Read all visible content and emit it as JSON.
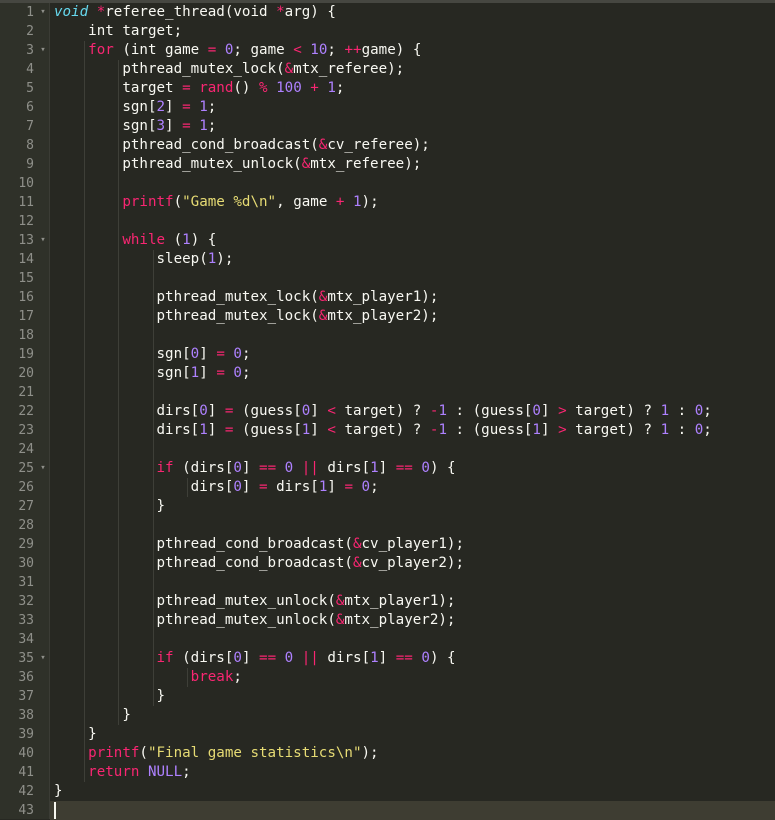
{
  "editor": {
    "theme_colors": {
      "background": "#272822",
      "gutter": "#2f3129",
      "keyword": "#f92672",
      "number": "#ae81ff",
      "string": "#e6db74",
      "text": "#f8f8f2"
    },
    "fold_icon": "fold-arrow-icon",
    "current_line": 43,
    "lines": [
      {
        "n": "1",
        "fold": true,
        "tokens": [
          [
            "t",
            "void"
          ],
          [
            "p",
            " "
          ],
          [
            "o",
            "*"
          ],
          [
            "p",
            "referee_thread(void "
          ],
          [
            "o",
            "*"
          ],
          [
            "p",
            "arg) {"
          ]
        ]
      },
      {
        "n": "2",
        "tokens": [
          [
            "p",
            "    int target;"
          ]
        ]
      },
      {
        "n": "3",
        "fold": true,
        "tokens": [
          [
            "p",
            "    "
          ],
          [
            "k",
            "for"
          ],
          [
            "p",
            " (int game "
          ],
          [
            "o",
            "="
          ],
          [
            "p",
            " "
          ],
          [
            "n",
            "0"
          ],
          [
            "p",
            "; game "
          ],
          [
            "o",
            "<"
          ],
          [
            "p",
            " "
          ],
          [
            "n",
            "10"
          ],
          [
            "p",
            "; "
          ],
          [
            "o",
            "++"
          ],
          [
            "p",
            "game) {"
          ]
        ]
      },
      {
        "n": "4",
        "tokens": [
          [
            "p",
            "        pthread_mutex_lock("
          ],
          [
            "o",
            "&"
          ],
          [
            "p",
            "mtx_referee);"
          ]
        ]
      },
      {
        "n": "5",
        "tokens": [
          [
            "p",
            "        target "
          ],
          [
            "o",
            "="
          ],
          [
            "p",
            " "
          ],
          [
            "k",
            "rand"
          ],
          [
            "p",
            "() "
          ],
          [
            "o",
            "%"
          ],
          [
            "p",
            " "
          ],
          [
            "n",
            "100"
          ],
          [
            "p",
            " "
          ],
          [
            "o",
            "+"
          ],
          [
            "p",
            " "
          ],
          [
            "n",
            "1"
          ],
          [
            "p",
            ";"
          ]
        ]
      },
      {
        "n": "6",
        "tokens": [
          [
            "p",
            "        sgn["
          ],
          [
            "n",
            "2"
          ],
          [
            "p",
            "] "
          ],
          [
            "o",
            "="
          ],
          [
            "p",
            " "
          ],
          [
            "n",
            "1"
          ],
          [
            "p",
            ";"
          ]
        ]
      },
      {
        "n": "7",
        "tokens": [
          [
            "p",
            "        sgn["
          ],
          [
            "n",
            "3"
          ],
          [
            "p",
            "] "
          ],
          [
            "o",
            "="
          ],
          [
            "p",
            " "
          ],
          [
            "n",
            "1"
          ],
          [
            "p",
            ";"
          ]
        ]
      },
      {
        "n": "8",
        "tokens": [
          [
            "p",
            "        pthread_cond_broadcast("
          ],
          [
            "o",
            "&"
          ],
          [
            "p",
            "cv_referee);"
          ]
        ]
      },
      {
        "n": "9",
        "tokens": [
          [
            "p",
            "        pthread_mutex_unlock("
          ],
          [
            "o",
            "&"
          ],
          [
            "p",
            "mtx_referee);"
          ]
        ]
      },
      {
        "n": "10",
        "tokens": []
      },
      {
        "n": "11",
        "tokens": [
          [
            "p",
            "        "
          ],
          [
            "k",
            "printf"
          ],
          [
            "p",
            "("
          ],
          [
            "s",
            "\"Game %d\\n\""
          ],
          [
            "p",
            ", game "
          ],
          [
            "o",
            "+"
          ],
          [
            "p",
            " "
          ],
          [
            "n",
            "1"
          ],
          [
            "p",
            ");"
          ]
        ]
      },
      {
        "n": "12",
        "tokens": []
      },
      {
        "n": "13",
        "fold": true,
        "tokens": [
          [
            "p",
            "        "
          ],
          [
            "k",
            "while"
          ],
          [
            "p",
            " ("
          ],
          [
            "n",
            "1"
          ],
          [
            "p",
            ") {"
          ]
        ]
      },
      {
        "n": "14",
        "tokens": [
          [
            "p",
            "            sleep("
          ],
          [
            "n",
            "1"
          ],
          [
            "p",
            ");"
          ]
        ]
      },
      {
        "n": "15",
        "tokens": []
      },
      {
        "n": "16",
        "tokens": [
          [
            "p",
            "            pthread_mutex_lock("
          ],
          [
            "o",
            "&"
          ],
          [
            "p",
            "mtx_player1);"
          ]
        ]
      },
      {
        "n": "17",
        "tokens": [
          [
            "p",
            "            pthread_mutex_lock("
          ],
          [
            "o",
            "&"
          ],
          [
            "p",
            "mtx_player2);"
          ]
        ]
      },
      {
        "n": "18",
        "tokens": []
      },
      {
        "n": "19",
        "tokens": [
          [
            "p",
            "            sgn["
          ],
          [
            "n",
            "0"
          ],
          [
            "p",
            "] "
          ],
          [
            "o",
            "="
          ],
          [
            "p",
            " "
          ],
          [
            "n",
            "0"
          ],
          [
            "p",
            ";"
          ]
        ]
      },
      {
        "n": "20",
        "tokens": [
          [
            "p",
            "            sgn["
          ],
          [
            "n",
            "1"
          ],
          [
            "p",
            "] "
          ],
          [
            "o",
            "="
          ],
          [
            "p",
            " "
          ],
          [
            "n",
            "0"
          ],
          [
            "p",
            ";"
          ]
        ]
      },
      {
        "n": "21",
        "tokens": []
      },
      {
        "n": "22",
        "tokens": [
          [
            "p",
            "            dirs["
          ],
          [
            "n",
            "0"
          ],
          [
            "p",
            "] "
          ],
          [
            "o",
            "="
          ],
          [
            "p",
            " (guess["
          ],
          [
            "n",
            "0"
          ],
          [
            "p",
            "] "
          ],
          [
            "o",
            "<"
          ],
          [
            "p",
            " target) ? "
          ],
          [
            "o",
            "-"
          ],
          [
            "n",
            "1"
          ],
          [
            "p",
            " : (guess["
          ],
          [
            "n",
            "0"
          ],
          [
            "p",
            "] "
          ],
          [
            "o",
            ">"
          ],
          [
            "p",
            " target) ? "
          ],
          [
            "n",
            "1"
          ],
          [
            "p",
            " : "
          ],
          [
            "n",
            "0"
          ],
          [
            "p",
            ";"
          ]
        ]
      },
      {
        "n": "23",
        "tokens": [
          [
            "p",
            "            dirs["
          ],
          [
            "n",
            "1"
          ],
          [
            "p",
            "] "
          ],
          [
            "o",
            "="
          ],
          [
            "p",
            " (guess["
          ],
          [
            "n",
            "1"
          ],
          [
            "p",
            "] "
          ],
          [
            "o",
            "<"
          ],
          [
            "p",
            " target) ? "
          ],
          [
            "o",
            "-"
          ],
          [
            "n",
            "1"
          ],
          [
            "p",
            " : (guess["
          ],
          [
            "n",
            "1"
          ],
          [
            "p",
            "] "
          ],
          [
            "o",
            ">"
          ],
          [
            "p",
            " target) ? "
          ],
          [
            "n",
            "1"
          ],
          [
            "p",
            " : "
          ],
          [
            "n",
            "0"
          ],
          [
            "p",
            ";"
          ]
        ]
      },
      {
        "n": "24",
        "tokens": []
      },
      {
        "n": "25",
        "fold": true,
        "tokens": [
          [
            "p",
            "            "
          ],
          [
            "k",
            "if"
          ],
          [
            "p",
            " (dirs["
          ],
          [
            "n",
            "0"
          ],
          [
            "p",
            "] "
          ],
          [
            "o",
            "=="
          ],
          [
            "p",
            " "
          ],
          [
            "n",
            "0"
          ],
          [
            "p",
            " "
          ],
          [
            "o",
            "||"
          ],
          [
            "p",
            " dirs["
          ],
          [
            "n",
            "1"
          ],
          [
            "p",
            "] "
          ],
          [
            "o",
            "=="
          ],
          [
            "p",
            " "
          ],
          [
            "n",
            "0"
          ],
          [
            "p",
            ") {"
          ]
        ]
      },
      {
        "n": "26",
        "tokens": [
          [
            "p",
            "                dirs["
          ],
          [
            "n",
            "0"
          ],
          [
            "p",
            "] "
          ],
          [
            "o",
            "="
          ],
          [
            "p",
            " dirs["
          ],
          [
            "n",
            "1"
          ],
          [
            "p",
            "] "
          ],
          [
            "o",
            "="
          ],
          [
            "p",
            " "
          ],
          [
            "n",
            "0"
          ],
          [
            "p",
            ";"
          ]
        ]
      },
      {
        "n": "27",
        "tokens": [
          [
            "p",
            "            }"
          ]
        ]
      },
      {
        "n": "28",
        "tokens": []
      },
      {
        "n": "29",
        "tokens": [
          [
            "p",
            "            pthread_cond_broadcast("
          ],
          [
            "o",
            "&"
          ],
          [
            "p",
            "cv_player1);"
          ]
        ]
      },
      {
        "n": "30",
        "tokens": [
          [
            "p",
            "            pthread_cond_broadcast("
          ],
          [
            "o",
            "&"
          ],
          [
            "p",
            "cv_player2);"
          ]
        ]
      },
      {
        "n": "31",
        "tokens": []
      },
      {
        "n": "32",
        "tokens": [
          [
            "p",
            "            pthread_mutex_unlock("
          ],
          [
            "o",
            "&"
          ],
          [
            "p",
            "mtx_player1);"
          ]
        ]
      },
      {
        "n": "33",
        "tokens": [
          [
            "p",
            "            pthread_mutex_unlock("
          ],
          [
            "o",
            "&"
          ],
          [
            "p",
            "mtx_player2);"
          ]
        ]
      },
      {
        "n": "34",
        "tokens": []
      },
      {
        "n": "35",
        "fold": true,
        "tokens": [
          [
            "p",
            "            "
          ],
          [
            "k",
            "if"
          ],
          [
            "p",
            " (dirs["
          ],
          [
            "n",
            "0"
          ],
          [
            "p",
            "] "
          ],
          [
            "o",
            "=="
          ],
          [
            "p",
            " "
          ],
          [
            "n",
            "0"
          ],
          [
            "p",
            " "
          ],
          [
            "o",
            "||"
          ],
          [
            "p",
            " dirs["
          ],
          [
            "n",
            "1"
          ],
          [
            "p",
            "] "
          ],
          [
            "o",
            "=="
          ],
          [
            "p",
            " "
          ],
          [
            "n",
            "0"
          ],
          [
            "p",
            ") {"
          ]
        ]
      },
      {
        "n": "36",
        "tokens": [
          [
            "p",
            "                "
          ],
          [
            "k",
            "break"
          ],
          [
            "p",
            ";"
          ]
        ]
      },
      {
        "n": "37",
        "tokens": [
          [
            "p",
            "            }"
          ]
        ]
      },
      {
        "n": "38",
        "tokens": [
          [
            "p",
            "        }"
          ]
        ]
      },
      {
        "n": "39",
        "tokens": [
          [
            "p",
            "    }"
          ]
        ]
      },
      {
        "n": "40",
        "tokens": [
          [
            "p",
            "    "
          ],
          [
            "k",
            "printf"
          ],
          [
            "p",
            "("
          ],
          [
            "s",
            "\"Final game statistics\\n\""
          ],
          [
            "p",
            ");"
          ]
        ]
      },
      {
        "n": "41",
        "tokens": [
          [
            "p",
            "    "
          ],
          [
            "k",
            "return"
          ],
          [
            "p",
            " "
          ],
          [
            "n",
            "NULL"
          ],
          [
            "p",
            ";"
          ]
        ]
      },
      {
        "n": "42",
        "tokens": [
          [
            "p",
            "}"
          ]
        ]
      },
      {
        "n": "43",
        "tokens": []
      }
    ]
  }
}
